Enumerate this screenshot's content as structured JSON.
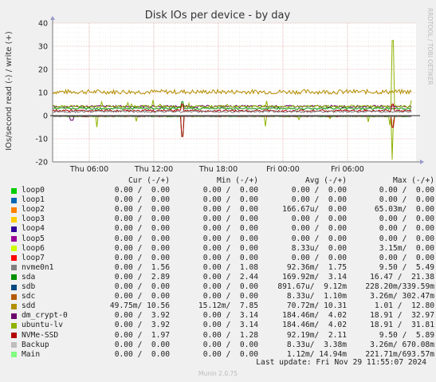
{
  "chart_data": {
    "type": "line",
    "title": "Disk IOs per device - by day",
    "ylabel": "IOs/second read (-) / write (+)",
    "ylim": [
      -20,
      40
    ],
    "yticks": [
      "-20",
      "-10",
      "0",
      "10",
      "20",
      "30",
      "40"
    ],
    "xticks": [
      "Thu 06:00",
      "Thu 12:00",
      "Thu 18:00",
      "Fri 00:00",
      "Fri 06:00"
    ],
    "grid": true,
    "legend_placement": "bottom",
    "side_credit": "RRDTOOL / TOBI OETIKER",
    "columns": [
      "Cur (-/+)",
      "Min (-/+)",
      "Avg (-/+)",
      "Max (-/+)"
    ],
    "series": [
      {
        "name": "loop0",
        "color": "#00cc00",
        "cur": "0.00 /  0.00",
        "min": "0.00 /  0.00",
        "avg": "0.00 /  0.00",
        "max": "0.00 /  0.00"
      },
      {
        "name": "loop1",
        "color": "#0066b3",
        "cur": "0.00 /  0.00",
        "min": "0.00 /  0.00",
        "avg": "0.00 /  0.00",
        "max": "0.00 /  0.00"
      },
      {
        "name": "loop2",
        "color": "#ff8000",
        "cur": "0.00 /  0.00",
        "min": "0.00 /  0.00",
        "avg": "166.67u/  0.00",
        "max": "65.03m/  0.00"
      },
      {
        "name": "loop3",
        "color": "#ffcc00",
        "cur": "0.00 /  0.00",
        "min": "0.00 /  0.00",
        "avg": "0.00 /  0.00",
        "max": "0.00 /  0.00"
      },
      {
        "name": "loop4",
        "color": "#330099",
        "cur": "0.00 /  0.00",
        "min": "0.00 /  0.00",
        "avg": "0.00 /  0.00",
        "max": "0.00 /  0.00"
      },
      {
        "name": "loop5",
        "color": "#990099",
        "cur": "0.00 /  0.00",
        "min": "0.00 /  0.00",
        "avg": "0.00 /  0.00",
        "max": "0.00 /  0.00"
      },
      {
        "name": "loop6",
        "color": "#ccff00",
        "cur": "0.00 /  0.00",
        "min": "0.00 /  0.00",
        "avg": "8.33u/  0.00",
        "max": "3.15m/  0.00"
      },
      {
        "name": "loop7",
        "color": "#ff0000",
        "cur": "0.00 /  0.00",
        "min": "0.00 /  0.00",
        "avg": "0.00 /  0.00",
        "max": "0.00 /  0.00"
      },
      {
        "name": "nvme0n1",
        "color": "#808080",
        "cur": "0.00 /  1.56",
        "min": "0.00 /  1.08",
        "avg": "92.36m/  1.75",
        "max": "9.50 /  5.49"
      },
      {
        "name": "sda",
        "color": "#008f00",
        "cur": "0.00 /  2.89",
        "min": "0.00 /  2.44",
        "avg": "169.92m/  3.14",
        "max": "16.47 /  21.38"
      },
      {
        "name": "sdb",
        "color": "#00487d",
        "cur": "0.00 /  0.00",
        "min": "0.00 /  0.00",
        "avg": "891.67u/  9.12m",
        "max": "228.20m/339.59m"
      },
      {
        "name": "sdc",
        "color": "#b35a00",
        "cur": "0.00 /  0.00",
        "min": "0.00 /  0.00",
        "avg": "8.33u/  1.10m",
        "max": "3.26m/ 302.47m"
      },
      {
        "name": "sdd",
        "color": "#b38f00",
        "cur": "49.75m/ 10.56",
        "min": "15.12m/  7.85",
        "avg": "70.72m/ 10.31",
        "max": "1.01 /  12.80"
      },
      {
        "name": "dm_crypt-0",
        "color": "#6b006b",
        "cur": "0.00 /  3.92",
        "min": "0.00 /  3.14",
        "avg": "184.46m/  4.02",
        "max": "18.91 /  32.97"
      },
      {
        "name": "ubuntu-lv",
        "color": "#8fb300",
        "cur": "0.00 /  3.92",
        "min": "0.00 /  3.14",
        "avg": "184.46m/  4.02",
        "max": "18.91 /  31.81"
      },
      {
        "name": "NVMe-SSD",
        "color": "#b30000",
        "cur": "0.00 /  1.97",
        "min": "0.00 /  1.28",
        "avg": "92.19m/  2.11",
        "max": "9.50 /  5.89"
      },
      {
        "name": "Backup",
        "color": "#bebebe",
        "cur": "0.00 /  0.00",
        "min": "0.00 /  0.00",
        "avg": "8.33u/  3.38m",
        "max": "3.26m/ 670.08m"
      },
      {
        "name": "Main",
        "color": "#80ff80",
        "cur": "0.00 /  0.00",
        "min": "0.00 /  0.00",
        "avg": "1.12m/ 14.94m",
        "max": "221.71m/693.57m"
      }
    ],
    "plot_levels": [
      {
        "name": "sdd",
        "write": 10.3,
        "read": 0.07
      },
      {
        "name": "dm_crypt-0",
        "write": 4.0,
        "read": 0.18
      },
      {
        "name": "ubuntu-lv",
        "write": 4.0,
        "read": 0.18
      },
      {
        "name": "sda",
        "write": 3.1,
        "read": 0.17
      },
      {
        "name": "NVMe-SSD",
        "write": 2.1,
        "read": 0.09
      },
      {
        "name": "nvme0n1",
        "write": 1.75,
        "read": 0.09
      }
    ],
    "footer": "Last update: Fri Nov 29 11:55:07 2024",
    "version": "Munin 2.0.75"
  }
}
